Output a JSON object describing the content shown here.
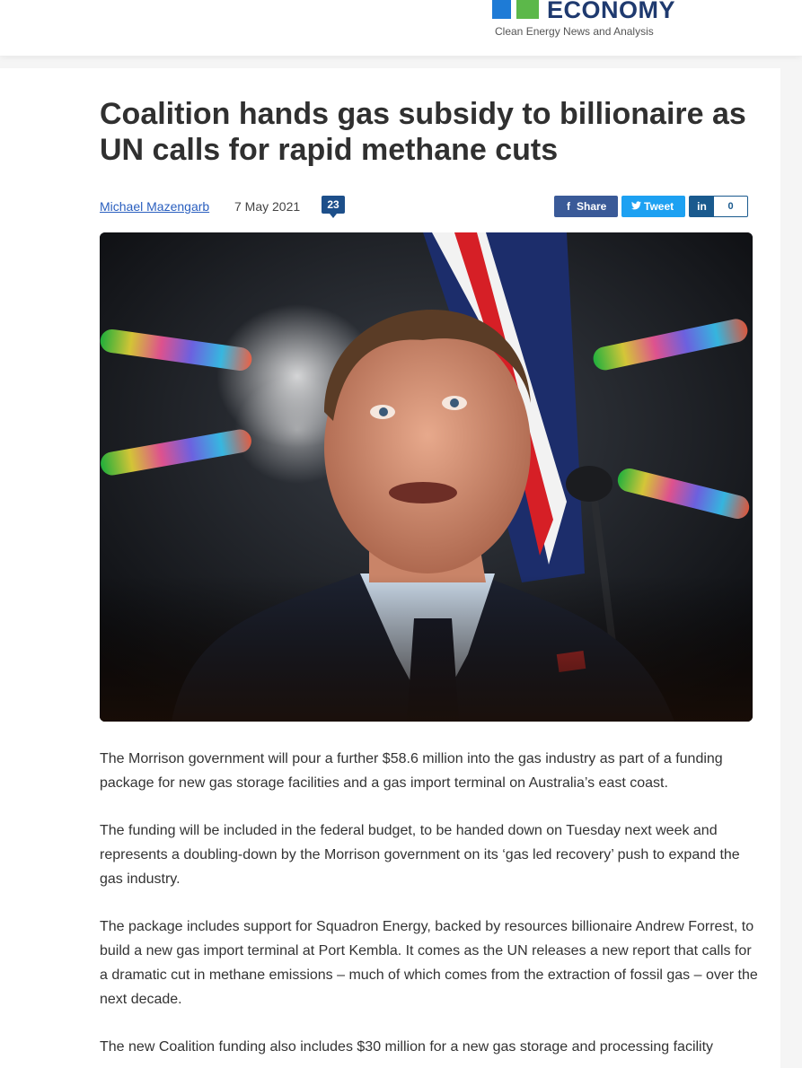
{
  "header": {
    "logo_word": "ECONOMY",
    "tagline": "Clean Energy News and Analysis",
    "logo_colors": [
      "#1e7bd6",
      "#5cb84a"
    ]
  },
  "article": {
    "title": "Coalition hands gas subsidy to billionaire as UN calls for rapid methane cuts",
    "author": "Michael Mazengarb",
    "date": "7 May 2021",
    "comment_count": "23",
    "image_icon": "photo-of-speaker-at-microphone",
    "paragraphs": [
      "The Morrison government will pour a further $58.6 million into the gas industry as part of a funding package for new gas storage facilities and a gas import terminal on Australia’s east coast.",
      "The funding will be included in the federal budget, to be handed down on Tuesday next week and represents a doubling-down by the Morrison government on its ‘gas led recovery’ push to expand the gas industry.",
      "The package includes support for Squadron Energy, backed by resources billionaire Andrew Forrest, to build a new gas import terminal at Port Kembla. It comes as the UN releases a new report that calls for a dramatic cut in methane emissions – much of which comes from the extraction of fossil gas – over the next decade.",
      "The new Coalition funding also includes $30 million for a new gas storage and processing facility"
    ]
  },
  "share": {
    "facebook_label": "Share",
    "twitter_label": "Tweet",
    "linkedin_label": "in",
    "linkedin_count": "0",
    "colors": {
      "facebook": "#3a5a98",
      "twitter": "#1da1f2",
      "linkedin": "#1a5a8e"
    }
  }
}
